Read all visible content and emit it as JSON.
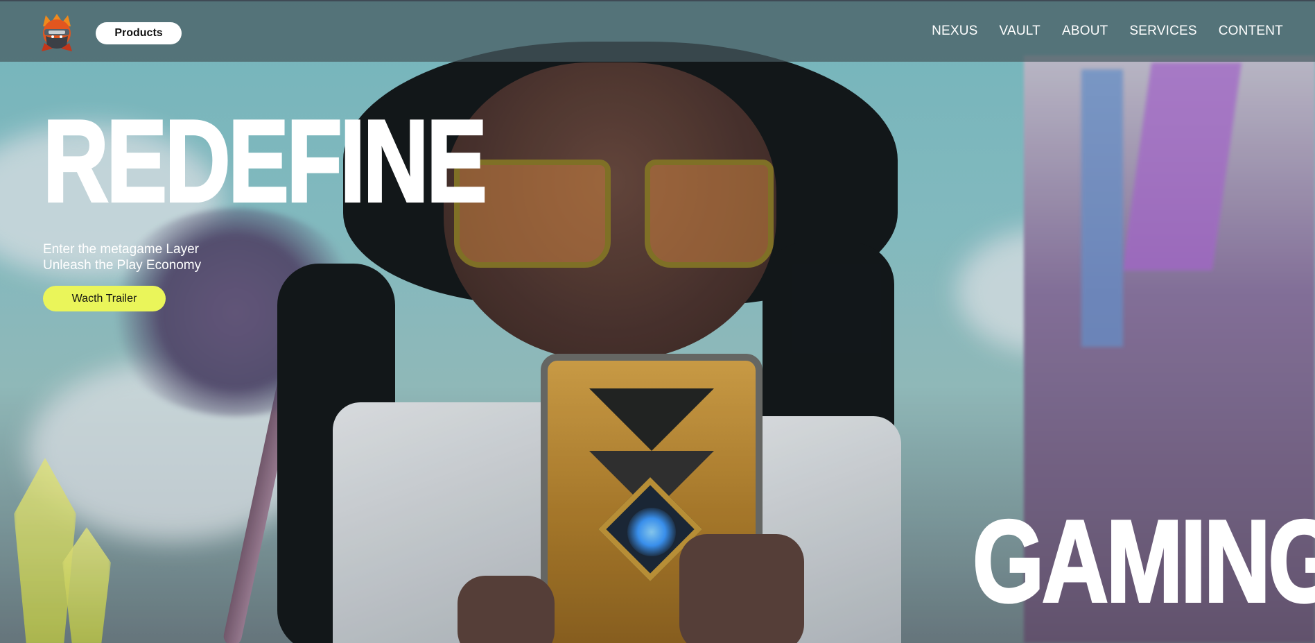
{
  "navbar": {
    "products_label": "Products",
    "links": [
      "NEXUS",
      "VAULT",
      "ABOUT",
      "SERVICES",
      "CONTENT"
    ]
  },
  "hero": {
    "headline_top": "REDEFINE",
    "tagline_line1": "Enter the metagame Layer",
    "tagline_line2": "Unleash the Play Economy",
    "trailer_button": "Wacth Trailer",
    "headline_bottom": "GAMING"
  },
  "colors": {
    "navbar_bg": "#465a5f",
    "trailer_button_bg": "#eaf55a",
    "headline": "#ffffff"
  },
  "icons": {
    "logo": "ninja-mascot-logo"
  }
}
